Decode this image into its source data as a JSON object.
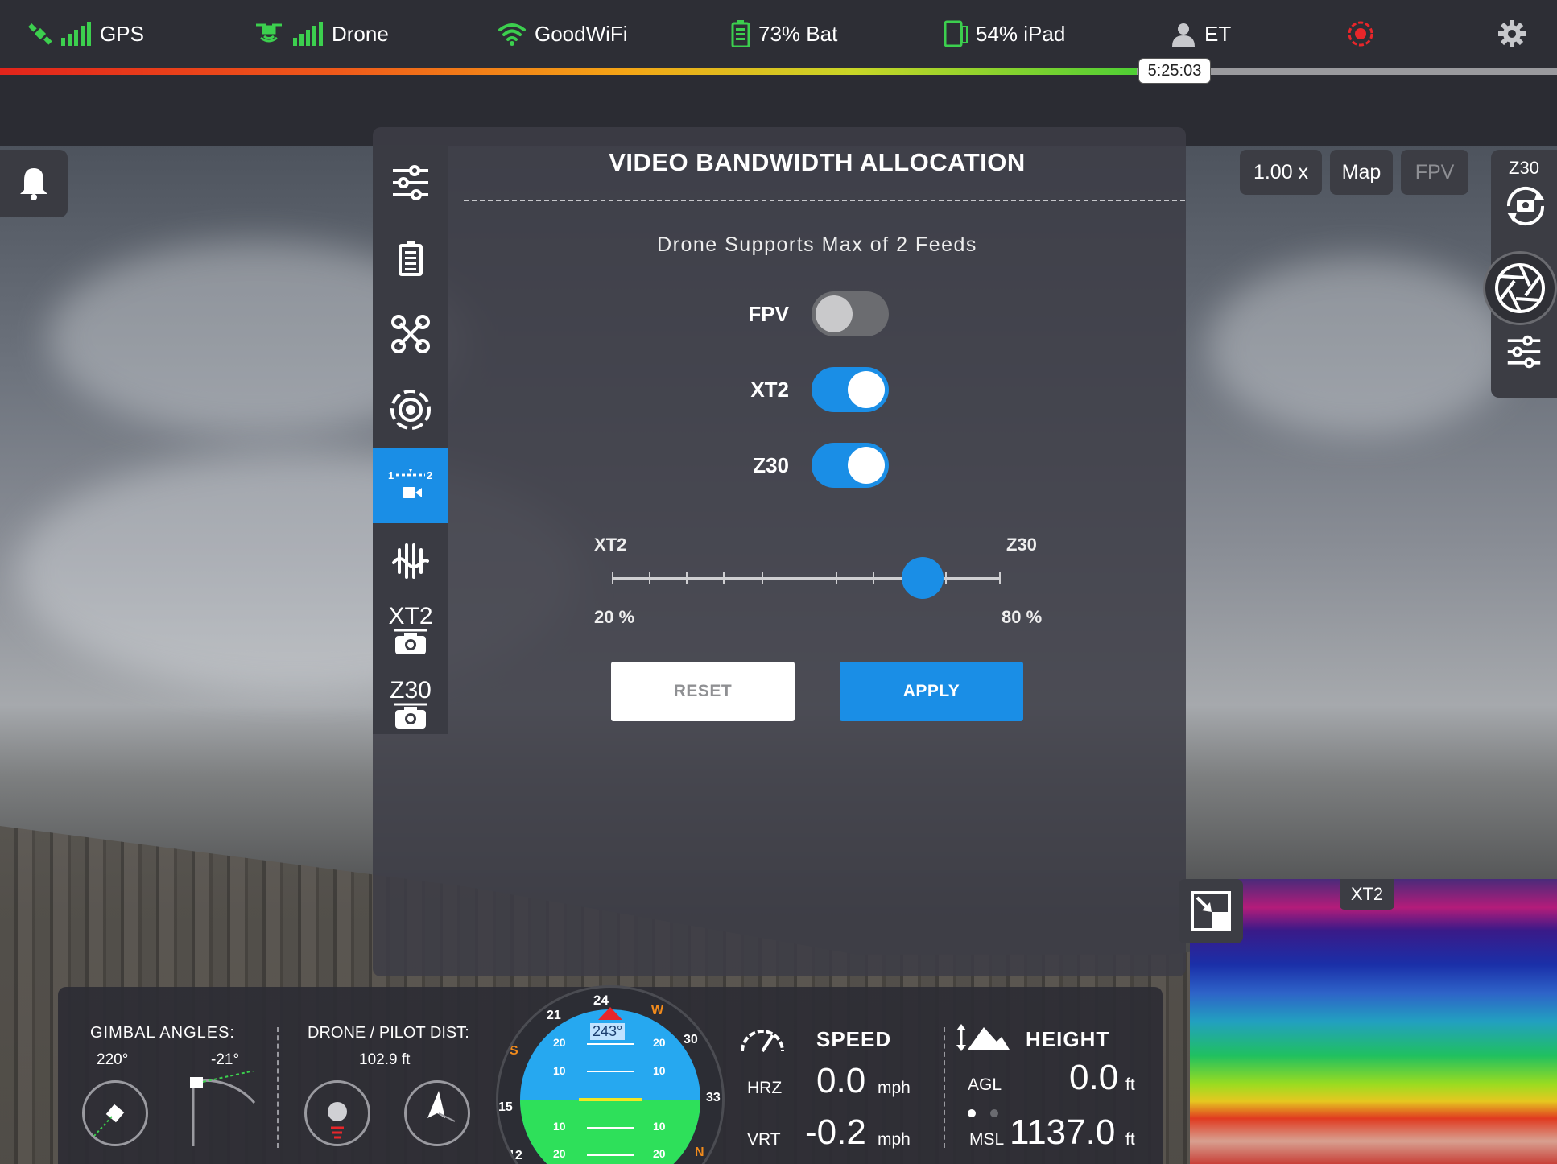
{
  "status": {
    "gps": "GPS",
    "drone": "Drone",
    "wifi": "GoodWiFi",
    "battery": "73% Bat",
    "ipad": "54% iPad",
    "user": "ET",
    "flight_time": "5:25:03",
    "battery_level": 0.73
  },
  "modal": {
    "title": "VIDEO BANDWIDTH ALLOCATION",
    "subtitle": "Drone Supports Max of 2 Feeds",
    "sidebar_cam1": "XT2",
    "sidebar_cam2": "Z30",
    "feeds": [
      {
        "label": "FPV",
        "enabled": false
      },
      {
        "label": "XT2",
        "enabled": true
      },
      {
        "label": "Z30",
        "enabled": true
      }
    ],
    "slider": {
      "left_label": "XT2",
      "right_label": "Z30",
      "left_value": "20 %",
      "right_value": "80 %",
      "position": 0.8
    },
    "reset_label": "RESET",
    "apply_label": "APPLY"
  },
  "view": {
    "zoom": "1.00 x",
    "map_label": "Map",
    "fpv_label": "FPV",
    "active_camera": "Z30",
    "pip_camera": "XT2"
  },
  "telemetry": {
    "gimbal_title": "GIMBAL ANGLES:",
    "gimbal_yaw": "220°",
    "gimbal_pitch": "-21°",
    "dist_title": "DRONE / PILOT DIST:",
    "dist_value": "102.9 ft",
    "heading": "243°",
    "compass_top": "24",
    "compass_w": "W",
    "compass_21": "21",
    "compass_s": "S",
    "compass_30": "30",
    "compass_15": "15",
    "compass_33": "33",
    "compass_12": "12",
    "compass_n": "N",
    "pitch_20": "20",
    "pitch_10": "10",
    "speed_title": "SPEED",
    "hrz_label": "HRZ",
    "hrz_value": "0.0",
    "vrt_label": "VRT",
    "vrt_value": "-0.2",
    "speed_unit": "mph",
    "height_title": "HEIGHT",
    "agl_label": "AGL",
    "agl_value": "0.0",
    "msl_label": "MSL",
    "msl_value": "1137.0",
    "height_unit": "ft"
  },
  "colors": {
    "accent": "#1a8ee6",
    "ok_green": "#3ccf4e",
    "record_red": "#e8262a"
  }
}
